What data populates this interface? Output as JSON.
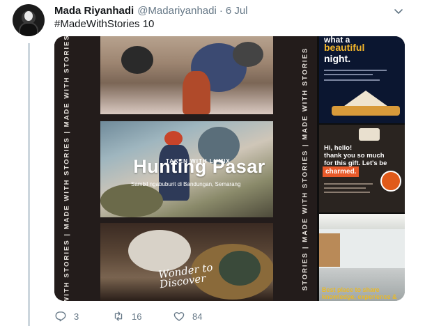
{
  "tweet": {
    "author_name": "Mada Riyanhadi",
    "author_handle": "@Madariyanhadi",
    "separator": "·",
    "date": "6 Jul",
    "text": "#MadeWithStories 10"
  },
  "media": {
    "side_banner_left": "WITH STORIES | MADE WITH STORIES | MADE WITH STORIES",
    "side_banner_right": "STORIES | MADE WITH STORIES | MADE WITH STORIES",
    "main": {
      "small_label": "TAKEN WITH LUMIX",
      "title": "Hunting Pasar",
      "subtitle": "Sambil ngabuburit di Bandungan, Semarang",
      "script_line1": "Wonder to",
      "script_line2": "Discover"
    },
    "tile_a": {
      "line1": "what a",
      "line2": "beautiful",
      "line3": "night."
    },
    "tile_b": {
      "line1": "Hi, hello!",
      "line2": "thank you so much",
      "line3": "for this gift. Let's be",
      "button": "charmed."
    },
    "tile_c": {
      "line1": "Best place to share",
      "line2": "knowledge, experience &"
    }
  },
  "actions": {
    "replies": "3",
    "retweets": "16",
    "likes": "84"
  },
  "colors": {
    "secondary_text": "#657786",
    "thread_line": "#ccd6dd",
    "accent_yellow": "#f2b52a",
    "accent_orange": "#e85a2a"
  }
}
